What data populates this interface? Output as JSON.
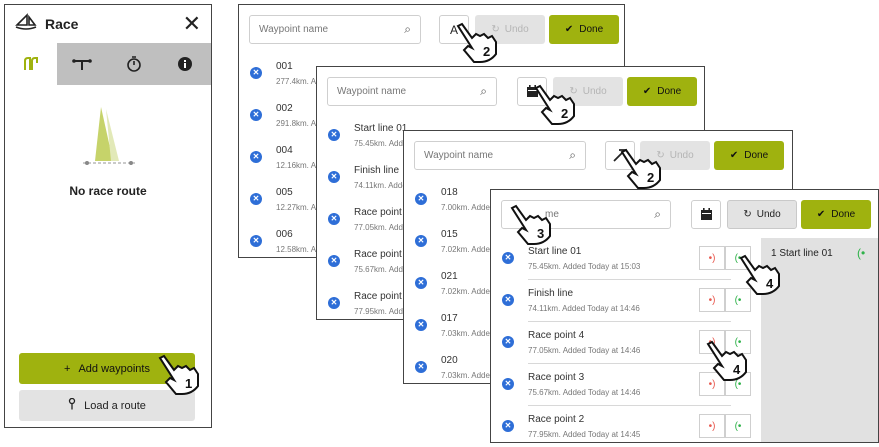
{
  "race_panel": {
    "title": "Race",
    "empty_label": "No race route",
    "add_waypoints": "Add waypoints",
    "load_route": "Load a route"
  },
  "common": {
    "search_placeholder": "Waypoint name",
    "undo": "Undo",
    "done": "Done"
  },
  "panel1": {
    "sort_glyph": "A",
    "rows": [
      {
        "name": "001",
        "sub": "277.4km. A"
      },
      {
        "name": "002",
        "sub": "291.8km. A"
      },
      {
        "name": "004",
        "sub": "12.16km. A"
      },
      {
        "name": "005",
        "sub": "12.27km. A"
      },
      {
        "name": "006",
        "sub": "12.58km. A"
      }
    ]
  },
  "panel2": {
    "rows": [
      {
        "name": "Start line 01",
        "sub": "75.45km. Added"
      },
      {
        "name": "Finish line",
        "sub": "74.11km. Added"
      },
      {
        "name": "Race point 4",
        "sub": "77.05km. Added"
      },
      {
        "name": "Race point 3",
        "sub": "75.67km. Added"
      },
      {
        "name": "Race point 2",
        "sub": "77.95km. Added"
      }
    ]
  },
  "panel3": {
    "rows": [
      {
        "name": "018",
        "sub": "7.00km. Added"
      },
      {
        "name": "015",
        "sub": "7.02km. Added"
      },
      {
        "name": "021",
        "sub": "7.02km. Added"
      },
      {
        "name": "017",
        "sub": "7.03km. Added"
      },
      {
        "name": "020",
        "sub": "7.03km. Added"
      }
    ]
  },
  "panel4": {
    "search_placeholder_visible": "me",
    "rows": [
      {
        "name": "Start line 01",
        "sub": "75.45km. Added Today at 15:03"
      },
      {
        "name": "Finish line",
        "sub": "74.11km. Added Today at 14:46"
      },
      {
        "name": "Race point 4",
        "sub": "77.05km. Added Today at 14:46"
      },
      {
        "name": "Race point 3",
        "sub": "75.67km. Added Today at 14:46"
      },
      {
        "name": "Race point 2",
        "sub": "77.95km. Added Today at 14:45"
      }
    ],
    "route": [
      {
        "index": "1",
        "name": "Start line 01"
      }
    ]
  },
  "callouts": [
    "1",
    "2",
    "2",
    "2",
    "3",
    "4",
    "4"
  ],
  "colors": {
    "accent": "#9fb20f",
    "remove_blue": "#2e6ed7",
    "start_green": "#2fb24a",
    "finish_red": "#e8584e"
  }
}
